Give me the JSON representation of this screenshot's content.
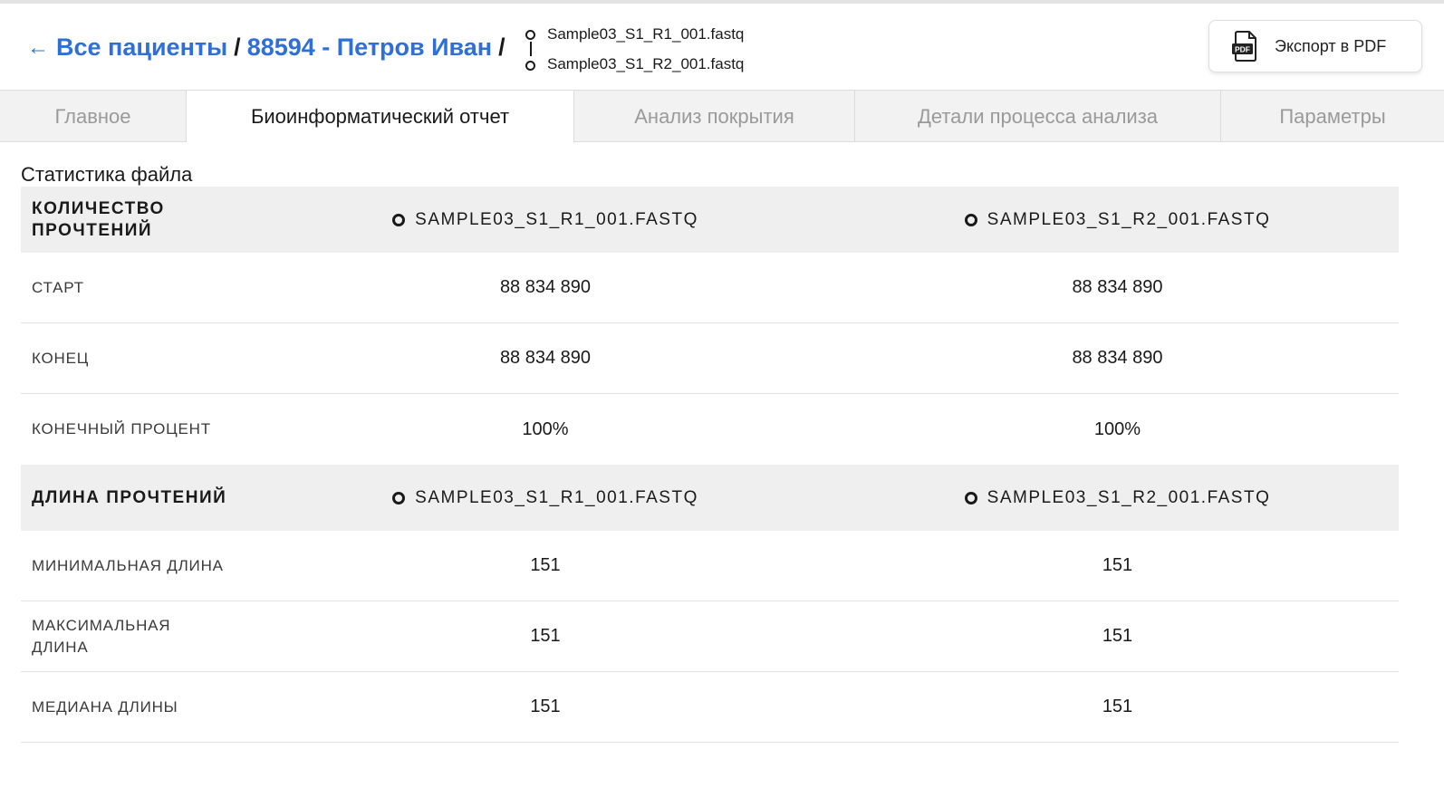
{
  "breadcrumb": {
    "back_arrow": "←",
    "back_label": "Все пациенты",
    "separator": "/",
    "patient": "88594 - Петров Иван"
  },
  "files": {
    "r1": "Sample03_S1_R1_001.fastq",
    "r2": "Sample03_S1_R2_001.fastq"
  },
  "export": {
    "icon": "pdf-file-icon",
    "icon_text": "PDF",
    "label": "Экспорт в PDF"
  },
  "tabs": [
    {
      "label": "Главное",
      "active": false
    },
    {
      "label": "Биоинформатический отчет",
      "active": true
    },
    {
      "label": "Анализ покрытия",
      "active": false
    },
    {
      "label": "Детали процесса анализа",
      "active": false
    },
    {
      "label": "Параметры",
      "active": false
    }
  ],
  "section_title": "Статистика файла",
  "reads_count": {
    "header": "КОЛИЧЕСТВО ПРОЧТЕНИЙ",
    "col1": "SAMPLE03_S1_R1_001.FASTQ",
    "col2": "SAMPLE03_S1_R2_001.FASTQ",
    "rows": [
      {
        "label": "СТАРТ",
        "v1": "88 834 890",
        "v2": "88 834 890"
      },
      {
        "label": "КОНЕЦ",
        "v1": "88 834 890",
        "v2": "88 834 890"
      },
      {
        "label": "КОНЕЧНЫЙ ПРОЦЕНТ",
        "v1": "100%",
        "v2": "100%"
      }
    ]
  },
  "reads_length": {
    "header": "ДЛИНА ПРОЧТЕНИЙ",
    "col1": "SAMPLE03_S1_R1_001.FASTQ",
    "col2": "SAMPLE03_S1_R2_001.FASTQ",
    "rows": [
      {
        "label": "МИНИМАЛЬНАЯ ДЛИНА",
        "v1": "151",
        "v2": "151"
      },
      {
        "label": "МАКСИМАЛЬНАЯ ДЛИНА",
        "v1": "151",
        "v2": "151"
      },
      {
        "label": "МЕДИАНА ДЛИНЫ",
        "v1": "151",
        "v2": "151"
      }
    ]
  },
  "colors": {
    "link": "#2f6fd6",
    "tab_bg": "#f2f2f2",
    "table_header_bg": "#efefef"
  }
}
